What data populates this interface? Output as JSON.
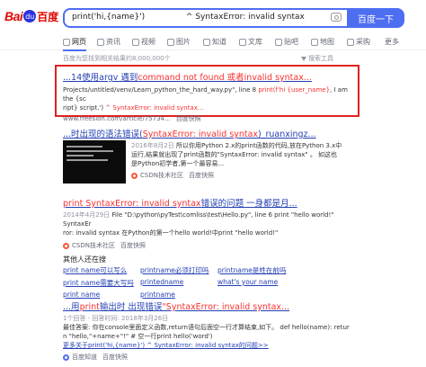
{
  "header": {
    "logo_text_left": "Bai",
    "logo_paw": "du",
    "logo_text_right": "百度",
    "search_query": "print('hi,{name}')                ^ SyntaxError: invalid syntax",
    "search_button": "百度一下"
  },
  "tabs": [
    {
      "label": "网页"
    },
    {
      "label": "资讯"
    },
    {
      "label": "视频"
    },
    {
      "label": "图片"
    },
    {
      "label": "知道"
    },
    {
      "label": "文库"
    },
    {
      "label": "贴吧"
    },
    {
      "label": "地图"
    },
    {
      "label": "采购"
    },
    {
      "label": "更多"
    }
  ],
  "result_count": "百度为您找到相关结果约8,000,000个",
  "search_tools": "搜索工具",
  "results": [
    {
      "title_a": "...14使用argv 遇到",
      "title_em": "command not found 或者invalid syntax...",
      "abs_line1_a": "Projects/untitled/venv/Learn_python_the_hard_way.py\", line 8 ",
      "abs_line1_em": "print(f'hi {user_name}",
      "abs_line1_b": ", I am the {sc",
      "abs_line2_a": "ript} script.')",
      "abs_line2_em": " ^ SyntaxError: invalid syntax...",
      "url": "www.freesion.com/article/75734...",
      "snapshot": "百度快照"
    },
    {
      "title_a": "...时出现的语法错误(",
      "title_em": "SyntaxError: invalid syntax",
      "title_b": ")_ruanxingz...",
      "date": "2016年8月2日",
      "abs_line1": " 所以你用Python 2.x的print函数的代码,放在Python 3.x中",
      "abs_line2": "运行,结果就出现了print函数的\"SyntaxError: invalid syntax\" 。 如这也",
      "abs_line3": "是Python初学者,第一个最容易...",
      "source": "CSDN技术社区",
      "snapshot": "百度快照"
    },
    {
      "title_em": "print SyntaxError: invalid syntax",
      "title_b": "错误的问题 一身都是月...",
      "date": "2014年4月29日",
      "abs_line1": " File \"D:\\python\\pyTest\\comliss\\test\\Hello.py\", line 6 print \"hello world!\" SyntaxEr",
      "abs_line2": "ror: invalid syntax 在Python的第一个hello world!中print \"hello world!\"",
      "source": "CSDN技术社区",
      "snapshot": "百度快照"
    }
  ],
  "related": {
    "title": "其他人还在搜",
    "items": [
      "print name可以写么",
      "printname必须打印吗",
      "printname是姓在前吗",
      "print name需要大写吗",
      "printedname",
      "what's your name",
      "print name",
      "printname"
    ]
  },
  "result4": {
    "title_a": "...用",
    "title_em1": "print",
    "title_b": "输出时 出现错误",
    "title_em2": "\"SyntaxError: invalid syntax...",
    "meta": "1个回答 - 回答时间: 2018年3月26日",
    "abs_line1": "最佳答案: 你在console里面定义函数,return语句后面空一行才算结束,如下。 def hello(name): retur",
    "abs_line2": "n \"hello,\"+name+\"!\" # 空一行print hello('word')",
    "more": "更多关于print('hi,{name}') ^ SyntaxError: invalid syntax的问题>>",
    "source": "百度知道",
    "snapshot": "百度快照"
  },
  "colors": {
    "accent": "#4e6ef2",
    "link": "#2440b3",
    "highlight": "#f73131",
    "box": "#e02020"
  }
}
